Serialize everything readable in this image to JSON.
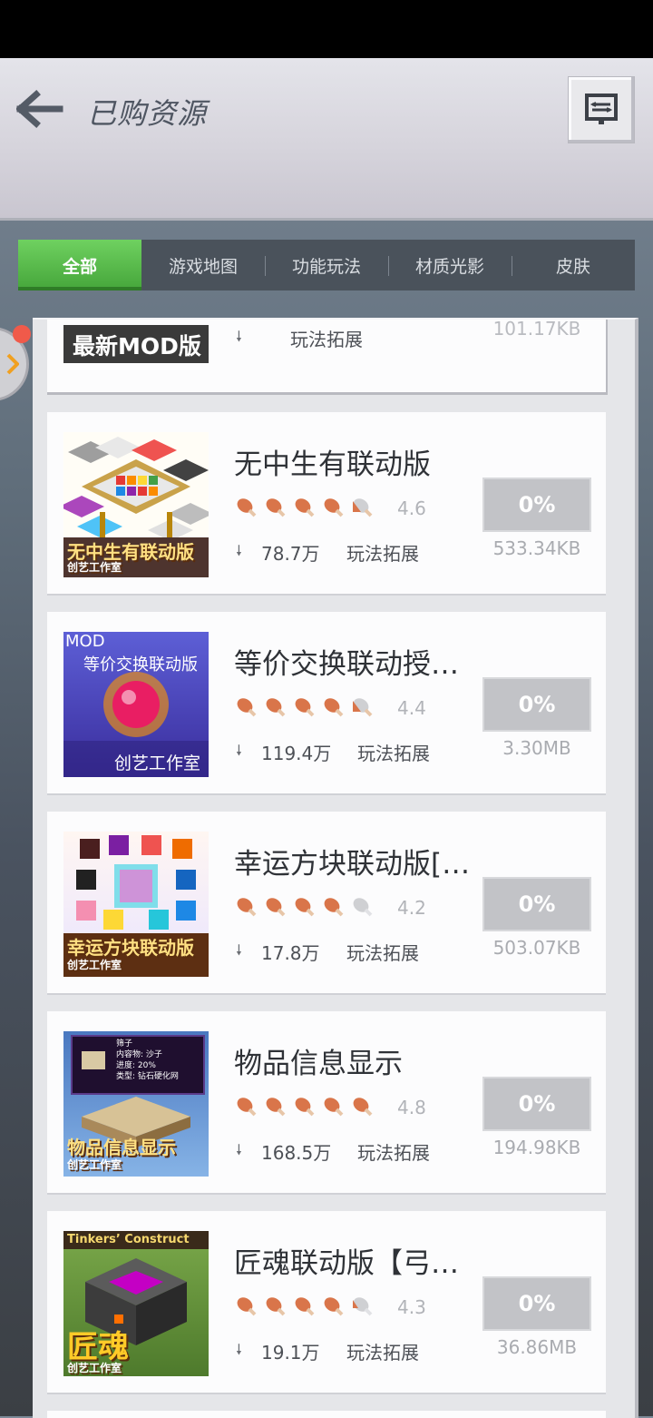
{
  "header": {
    "title": "已购资源",
    "back_icon": "arrow-left-icon",
    "action_icon": "manage-icon"
  },
  "tabs": [
    {
      "label": "全部",
      "active": true
    },
    {
      "label": "游戏地图",
      "active": false
    },
    {
      "label": "功能玩法",
      "active": false
    },
    {
      "label": "材质光影",
      "active": false
    },
    {
      "label": "皮肤",
      "active": false
    }
  ],
  "partial_item": {
    "badge": "最新MOD版",
    "category": "玩法拓展",
    "size": "101.17KB"
  },
  "items": [
    {
      "title": "无中生有联动版",
      "rating": "4.6",
      "rating_value": 4.6,
      "downloads": "78.7万",
      "category": "玩法拓展",
      "progress": "0%",
      "size": "533.34KB",
      "thumb_caption": "无中生有联动版",
      "thumb_studio": "创艺工作室"
    },
    {
      "title": "等价交换联动授…",
      "rating": "4.4",
      "rating_value": 4.4,
      "downloads": "119.4万",
      "category": "玩法拓展",
      "progress": "0%",
      "size": "3.30MB",
      "thumb_caption": "等价交换联动版",
      "thumb_tag": "MOD",
      "thumb_studio": "创艺工作室"
    },
    {
      "title": "幸运方块联动版[…",
      "rating": "4.2",
      "rating_value": 4.2,
      "downloads": "17.8万",
      "category": "玩法拓展",
      "progress": "0%",
      "size": "503.07KB",
      "thumb_caption": "幸运方块联动版",
      "thumb_studio": "创艺工作室"
    },
    {
      "title": "物品信息显示",
      "rating": "4.8",
      "rating_value": 4.8,
      "downloads": "168.5万",
      "category": "玩法拓展",
      "progress": "0%",
      "size": "194.98KB",
      "thumb_caption": "物品信息显示",
      "thumb_studio": "创艺工作室",
      "thumb_info": [
        "筛子",
        "内容物: 沙子",
        "进度: 20%",
        "类型: 钻石硬化网"
      ]
    },
    {
      "title": "匠魂联动版【弓…",
      "rating": "4.3",
      "rating_value": 4.3,
      "downloads": "19.1万",
      "category": "玩法拓展",
      "progress": "0%",
      "size": "36.86MB",
      "thumb_caption": "匠魂",
      "thumb_tag": "Tinkers’ Construct",
      "thumb_studio": "创艺工作室"
    }
  ],
  "colors": {
    "tab_active": "#4fb743",
    "tab_bar": "#4a525b",
    "star": "#d9754a",
    "progress_bg": "#c2c3c7"
  }
}
